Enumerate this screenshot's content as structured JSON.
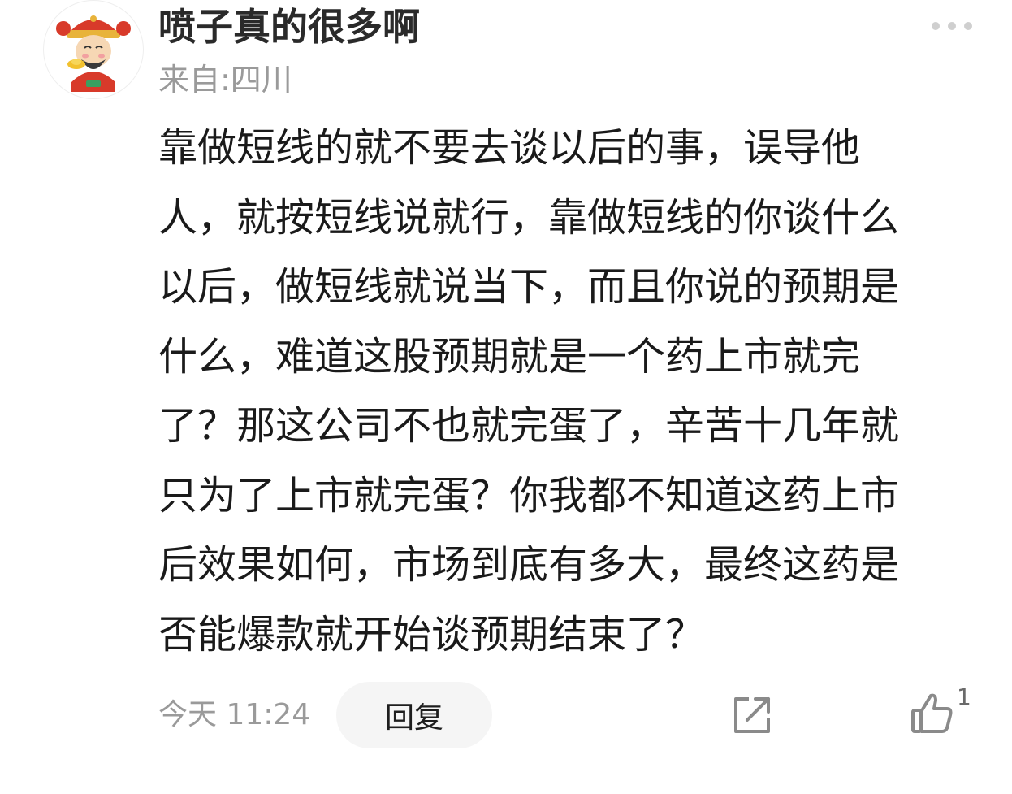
{
  "comment": {
    "username": "喷子真的很多啊",
    "location": "来自:四川",
    "body_lines": [
      "靠做短线的就不要去谈以后的事，误导他",
      "人，就按短线说就行，靠做短线的你谈什么",
      "以后，做短线就说当下，而且你说的预期是",
      "什么，难道这股预期就是一个药上市就完",
      "了？那这公司不也就完蛋了，辛苦十几年就",
      "只为了上市就完蛋？你我都不知道这药上市",
      "后效果如何，市场到底有多大，最终这药是",
      "否能爆款就开始谈预期结束了？"
    ],
    "timestamp": "今天 11:24",
    "reply_label": "回复",
    "like_count": "1"
  },
  "icons": {
    "avatar": "caishen-avatar",
    "more": "more-dots-icon",
    "share": "share-icon",
    "like": "thumbs-up-icon"
  },
  "colors": {
    "text_primary": "#1a1a1a",
    "text_secondary": "#9a9a9a",
    "reply_bg": "#f5f5f5",
    "icon_gray": "#8a8a8a"
  }
}
